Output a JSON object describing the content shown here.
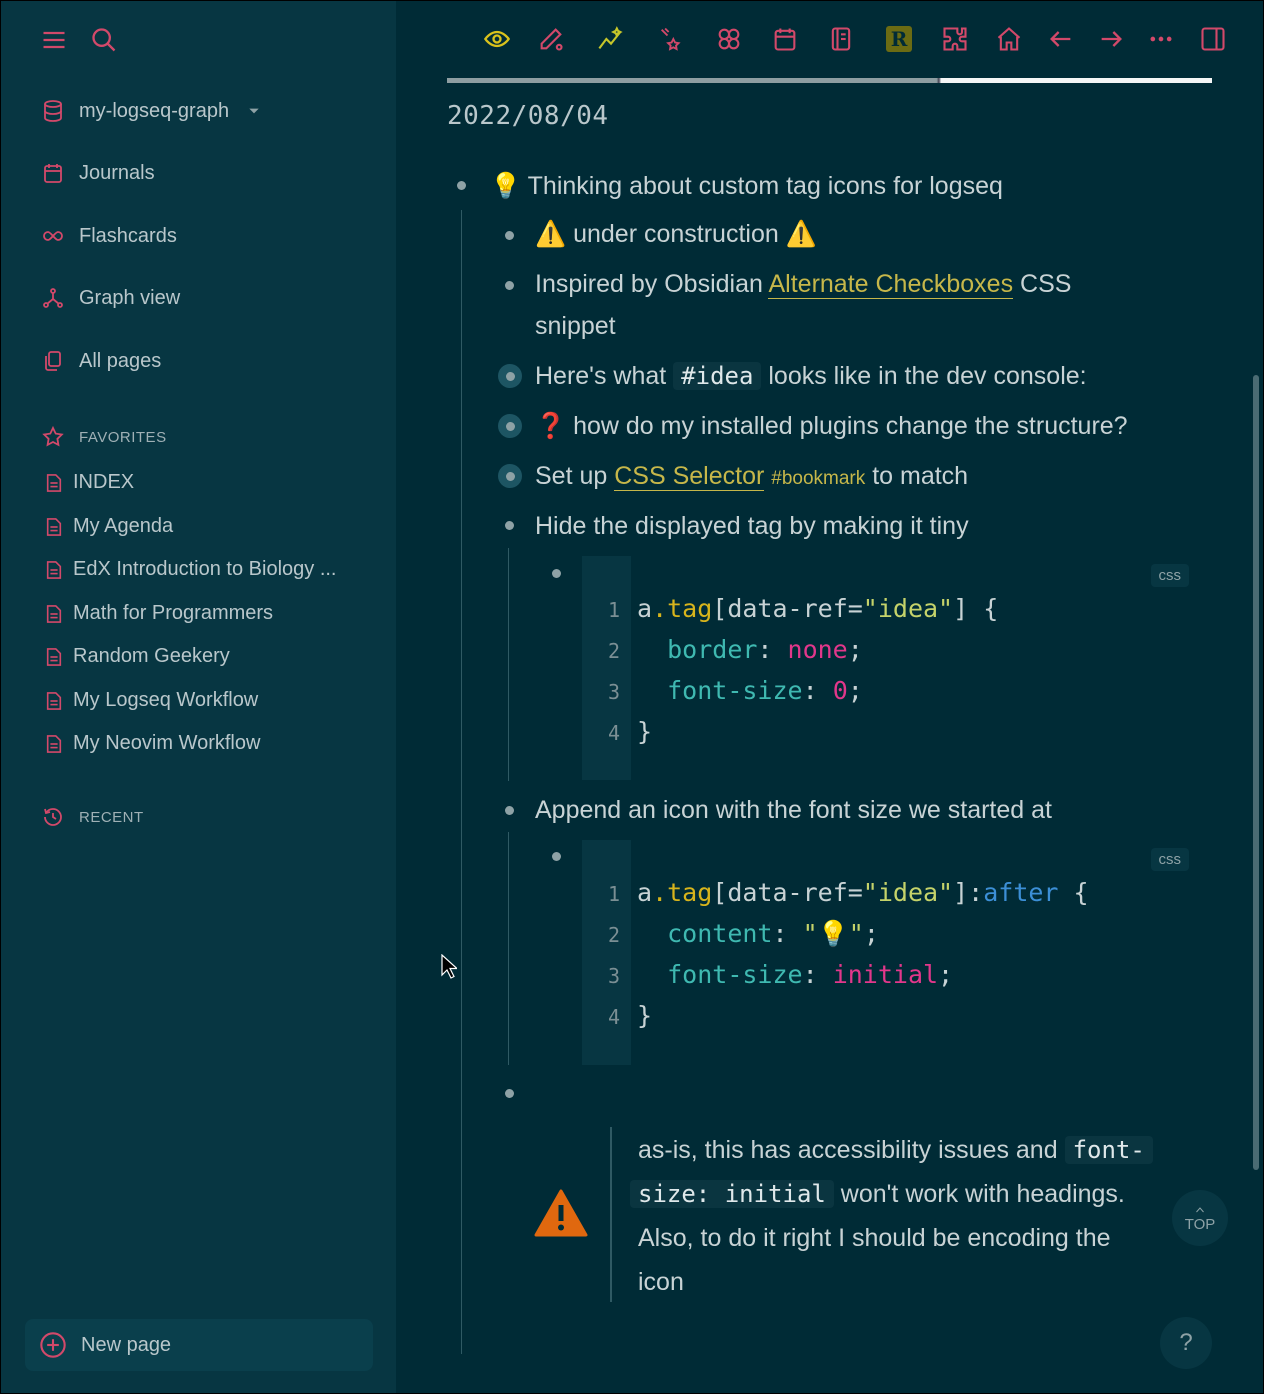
{
  "sidebar": {
    "graph_name": "my-logseq-graph",
    "nav": [
      {
        "label": "Journals",
        "icon": "calendar-icon"
      },
      {
        "label": "Flashcards",
        "icon": "infinity-icon"
      },
      {
        "label": "Graph view",
        "icon": "graph-icon"
      },
      {
        "label": "All pages",
        "icon": "pages-icon"
      }
    ],
    "favorites_heading": "FAVORITES",
    "favorites": [
      "INDEX",
      "My Agenda",
      "EdX Introduction to Biology ...",
      "Math for Programmers",
      "Random Geekery",
      "My Logseq Workflow",
      "My Neovim Workflow"
    ],
    "recent_heading": "RECENT",
    "new_page_label": "New page"
  },
  "toolbar": {
    "icons": [
      "eye-icon",
      "pencil-icon",
      "sparkline-icon",
      "stars-icon",
      "puzzle-knot-icon",
      "calendar-icon",
      "book-icon",
      "r-badge-icon",
      "plugin-icon",
      "home-icon",
      "arrow-left-icon",
      "arrow-right-icon",
      "more-icon",
      "sidebar-toggle-icon"
    ],
    "r_badge": "R"
  },
  "page": {
    "date": "2022/08/04",
    "blocks": {
      "b1": {
        "emoji": "💡",
        "text": "Thinking about custom tag icons for logseq"
      },
      "b2": {
        "pre": "⚠️",
        "text": "under construction",
        "post": "⚠️"
      },
      "b3": {
        "pre": "Inspired by Obsidian",
        "link": "Alternate Checkboxes",
        "post": "CSS",
        "line2": "snippet"
      },
      "b4": {
        "pre": "Here's what",
        "code": "#idea",
        "post": "looks like in the dev console:"
      },
      "b5": {
        "emoji": "❓",
        "text": "how do my installed plugins change the structure?"
      },
      "b6": {
        "pre": "Set up",
        "link": "CSS Selector",
        "tag": "#bookmark",
        "post": "to match"
      },
      "b7": {
        "text": "Hide the displayed tag by making it tiny"
      },
      "b8": {
        "text": "Append an icon with the font size we started at"
      }
    },
    "code1": {
      "lang": "css",
      "line_numbers": [
        "1",
        "2",
        "3",
        "4"
      ]
    },
    "code2": {
      "lang": "css",
      "line_numbers": [
        "1",
        "2",
        "3",
        "4"
      ]
    },
    "warning": {
      "t1": "as-is, this has accessibility issues and",
      "code1": "font-",
      "code2": "size: initial",
      "t2": "won't work with headings.",
      "t3": "Also, to do it right I should be encoding the",
      "t4": "icon"
    }
  },
  "top_button": "TOP",
  "help_button": "?"
}
